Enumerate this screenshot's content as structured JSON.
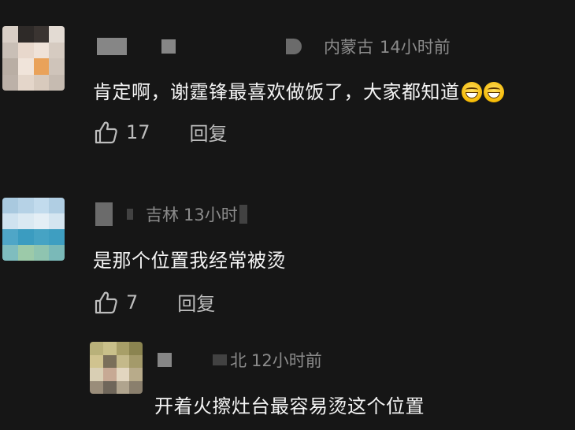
{
  "comments": [
    {
      "location": "内蒙古",
      "time": "14小时前",
      "text": "肯定啊，谢霆锋最喜欢做饭了，大家都知道",
      "emojis": [
        "grinning-face",
        "grinning-face"
      ],
      "likes": "17",
      "reply_label": "回复"
    },
    {
      "location": "吉林",
      "time": "13小时",
      "text": "是那个位置我经常被烫",
      "likes": "7",
      "reply_label": "回复"
    },
    {
      "location": "北",
      "time": "12小时前",
      "text": "开着火擦灶台最容易烫这个位置"
    }
  ],
  "colors": {
    "background": "#161616",
    "meta_text": "#8b8b8b",
    "body_text": "#f4f4f4",
    "action_text": "#bdbdbd"
  },
  "icons": {
    "like": "thumbs-up-outline-icon"
  }
}
